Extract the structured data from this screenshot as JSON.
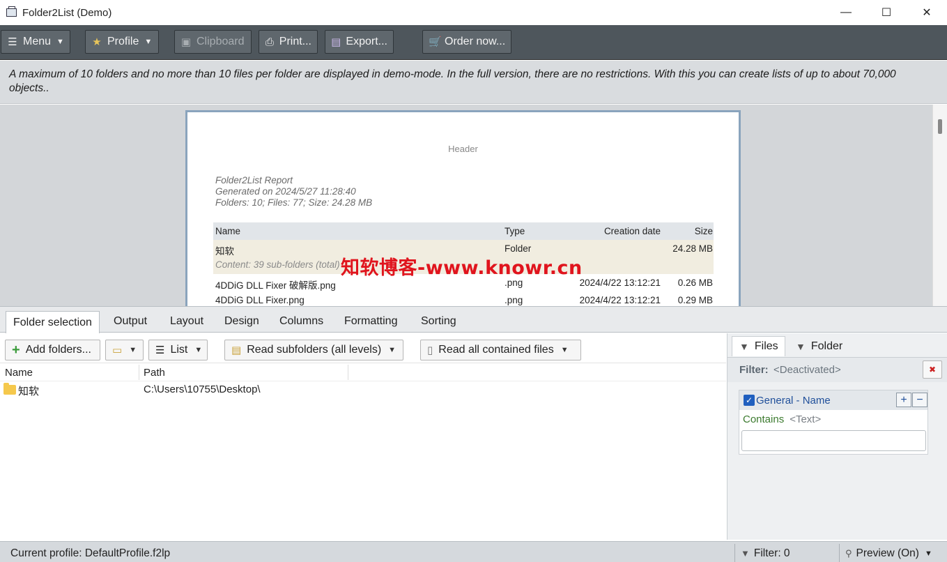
{
  "window": {
    "title": "Folder2List (Demo)",
    "controls": {
      "minimize": "—",
      "maximize": "☐",
      "close": "✕"
    }
  },
  "toolbar": {
    "menu_label": "Menu",
    "profile_label": "Profile",
    "clipboard_label": "Clipboard",
    "print_label": "Print...",
    "export_label": "Export...",
    "order_label": "Order now..."
  },
  "info_message": "A maximum of 10 folders and no more than 10 files per folder are displayed in demo-mode. In the full version, there are no restrictions. With this you can create lists of up to about 70,000 objects..",
  "report": {
    "header": "Header",
    "title": "Folder2List Report",
    "generated": "Generated on 2024/5/27 11:28:40",
    "stats": "Folders: 10;  Files: 77;  Size: 24.28 MB",
    "columns": {
      "name": "Name",
      "type": "Type",
      "created": "Creation date",
      "size": "Size"
    },
    "folder_row": {
      "name": "知软",
      "type": "Folder",
      "created": "",
      "size": "24.28 MB"
    },
    "folder_content": "Content: 39 sub-folders (total)",
    "rows": [
      {
        "name": "4DDiG DLL Fixer 破解版.png",
        "type": ".png",
        "created": "2024/4/22 13:12:21",
        "size": "0.26 MB"
      },
      {
        "name": "4DDiG DLL Fixer.png",
        "type": ".png",
        "created": "2024/4/22 13:12:21",
        "size": "0.29 MB"
      }
    ]
  },
  "watermark": "知软博客-www.knowr.cn",
  "tabs": [
    "Folder selection",
    "Output",
    "Layout",
    "Design",
    "Columns",
    "Formatting",
    "Sorting"
  ],
  "selection": {
    "add_folders_label": "Add folders...",
    "view_label": "List",
    "subfolders_label": "Read subfolders (all levels)",
    "files_label": "Read all contained files",
    "columns": {
      "name": "Name",
      "path": "Path"
    },
    "items": [
      {
        "name": "知软",
        "path": "C:\\Users\\10755\\Desktop\\"
      }
    ]
  },
  "filter_panel": {
    "tab_files": "Files",
    "tab_folder": "Folder",
    "filter_label": "Filter:",
    "filter_value": "<Deactivated>",
    "rule": {
      "field": "General - Name",
      "plus": "+",
      "minus": "−",
      "operator": "Contains",
      "value_placeholder": "<Text>",
      "text_value": ""
    }
  },
  "status": {
    "profile": "Current profile: DefaultProfile.f2lp",
    "filter": "Filter: 0",
    "preview": "Preview (On)"
  },
  "colors": {
    "toolbar_bg": "#4e565c",
    "accent_blue": "#1f5fbf",
    "watermark_red": "#e0141d"
  }
}
